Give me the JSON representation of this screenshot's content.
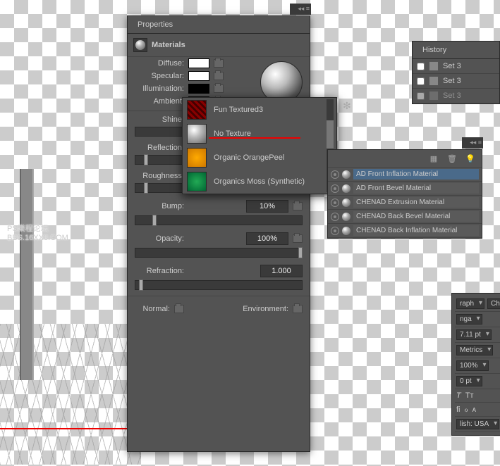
{
  "properties": {
    "title": "Properties",
    "section": "Materials",
    "diffuse": "Diffuse:",
    "specular": "Specular:",
    "illumination": "Illumination:",
    "ambient": "Ambient:",
    "shine": "Shine:",
    "reflection": "Reflection:",
    "roughness": "Roughness:",
    "bump": "Bump:",
    "bump_val": "10%",
    "opacity": "Opacity:",
    "opacity_val": "100%",
    "refraction": "Refraction:",
    "refraction_val": "1.000",
    "normal": "Normal:",
    "environment": "Environment:"
  },
  "textures": {
    "items": [
      {
        "label": "Fun Textured3",
        "bg": "repeating-linear-gradient(45deg,#800,#800 3px,#400 3px,#400 6px)"
      },
      {
        "label": "No Texture",
        "bg": "radial-gradient(circle at 35% 30%,#fff,#bbb 40%,#666)"
      },
      {
        "label": "Organic OrangePeel",
        "bg": "radial-gradient(circle,#fa0,#c70)"
      },
      {
        "label": "Organics Moss (Synthetic)",
        "bg": "radial-gradient(circle,#2a5,#063)"
      }
    ]
  },
  "layers": {
    "items": [
      {
        "label": "AD Front Inflation Material",
        "sel": true
      },
      {
        "label": "AD Front Bevel Material",
        "sel": false
      },
      {
        "label": "CHENAD Extrusion Material",
        "sel": false
      },
      {
        "label": "CHENAD Back Bevel Material",
        "sel": false
      },
      {
        "label": "CHENAD Back Inflation Material",
        "sel": false
      }
    ]
  },
  "history": {
    "title": "History",
    "items": [
      "Set 3",
      "Set 3",
      "Set 3"
    ]
  },
  "char": {
    "tab1": "raph",
    "tab2": "Ch",
    "font": "nga",
    "size": "7.11 pt",
    "kerning": "Metrics",
    "scale": "100%",
    "baseline": "0 pt",
    "lang": "lish: USA"
  },
  "watermark": {
    "l1": "PS樂程论坛",
    "l2": "BBS.16XX8.COM"
  }
}
